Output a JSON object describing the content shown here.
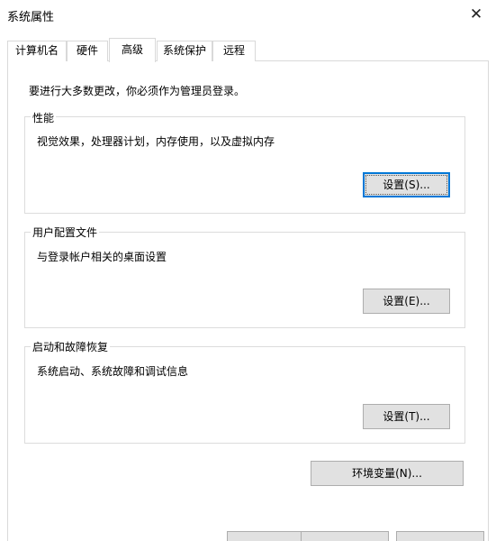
{
  "window": {
    "title": "系统属性",
    "close_glyph": "✕"
  },
  "tabs": [
    {
      "label": "计算机名"
    },
    {
      "label": "硬件"
    },
    {
      "label": "高级"
    },
    {
      "label": "系统保护"
    },
    {
      "label": "远程"
    }
  ],
  "active_tab": "高级",
  "admin_note": "要进行大多数更改，你必须作为管理员登录。",
  "groups": {
    "performance": {
      "label": "性能",
      "description": "视觉效果，处理器计划，内存使用，以及虚拟内存",
      "button": "设置(S)..."
    },
    "user_profiles": {
      "label": "用户配置文件",
      "description": "与登录帐户相关的桌面设置",
      "button": "设置(E)..."
    },
    "startup_recovery": {
      "label": "启动和故障恢复",
      "description": "系统启动、系统故障和调试信息",
      "button": "设置(T)..."
    }
  },
  "env_button": "环境变量(N)...",
  "colors": {
    "focus_border": "#0078d7",
    "button_face": "#e1e1e1",
    "button_border": "#adadad"
  }
}
